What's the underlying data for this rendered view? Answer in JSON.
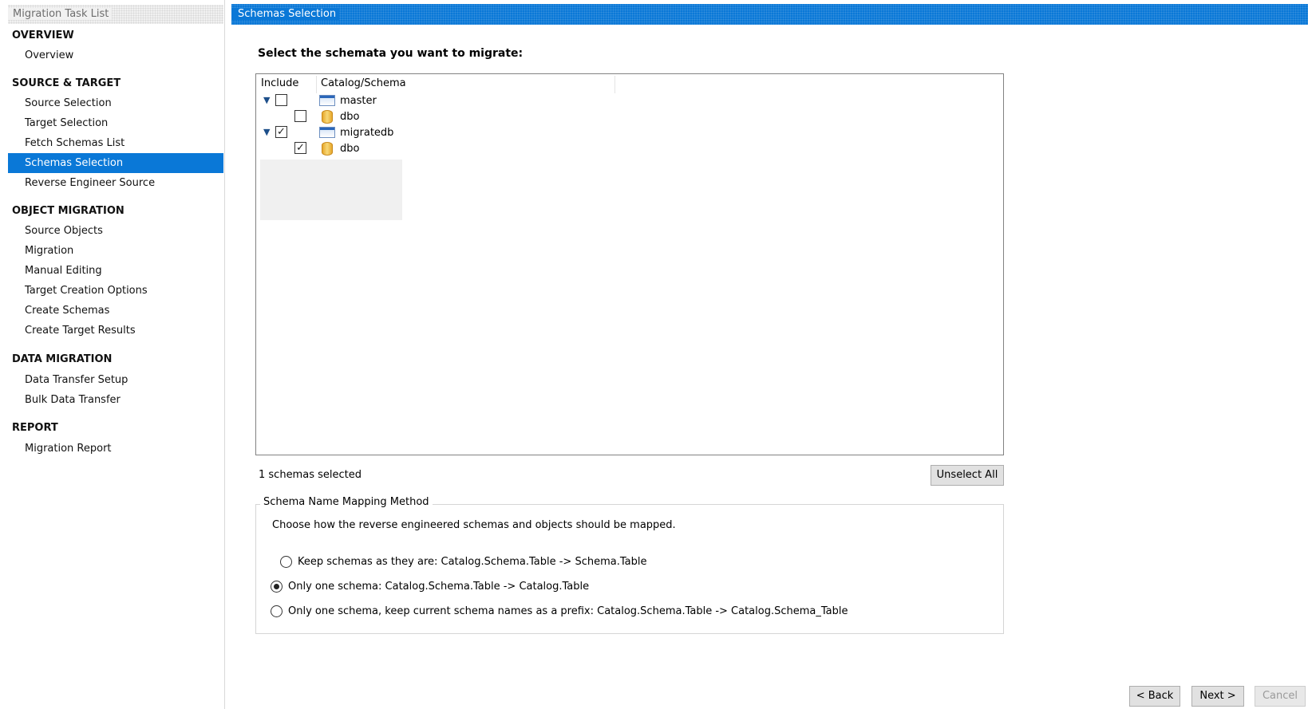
{
  "sidebar": {
    "header": "Migration Task List",
    "sections": [
      {
        "title": "OVERVIEW",
        "items": [
          "Overview"
        ]
      },
      {
        "title": "SOURCE & TARGET",
        "items": [
          "Source Selection",
          "Target Selection",
          "Fetch Schemas List",
          "Schemas Selection",
          "Reverse Engineer Source"
        ]
      },
      {
        "title": "OBJECT MIGRATION",
        "items": [
          "Source Objects",
          "Migration",
          "Manual Editing",
          "Target Creation Options",
          "Create Schemas",
          "Create Target Results"
        ]
      },
      {
        "title": "DATA MIGRATION",
        "items": [
          "Data Transfer Setup",
          "Bulk Data Transfer"
        ]
      },
      {
        "title": "REPORT",
        "items": [
          "Migration Report"
        ]
      }
    ],
    "active_item": "Schemas Selection"
  },
  "page": {
    "title": "Schemas Selection",
    "heading": "Select the schemata you want to migrate:"
  },
  "tree": {
    "columns": [
      "Include",
      "Catalog/Schema"
    ],
    "rows": [
      {
        "label": "master",
        "icon": "catalog-icon",
        "checked": false,
        "level": 0,
        "expanded": true
      },
      {
        "label": "dbo",
        "icon": "database-icon",
        "checked": false,
        "level": 1
      },
      {
        "label": "migratedb",
        "icon": "catalog-icon",
        "checked": true,
        "level": 0,
        "expanded": true
      },
      {
        "label": "dbo",
        "icon": "database-icon",
        "checked": true,
        "level": 1
      }
    ]
  },
  "status": {
    "selected_text": "1 schemas selected",
    "unselect_all_label": "Unselect All"
  },
  "mapping": {
    "legend": "Schema Name Mapping Method",
    "description": "Choose how the reverse engineered schemas and objects should be mapped.",
    "options": [
      {
        "label": "Keep schemas as they are: Catalog.Schema.Table -> Schema.Table",
        "checked": false
      },
      {
        "label": "Only one schema: Catalog.Schema.Table -> Catalog.Table",
        "checked": true
      },
      {
        "label": "Only one schema, keep current schema names as a prefix: Catalog.Schema.Table -> Catalog.Schema_Table",
        "checked": false
      }
    ]
  },
  "footer": {
    "back_label": "< Back",
    "next_label": "Next >",
    "cancel_label": "Cancel"
  },
  "colors": {
    "accent": "#0a78d7"
  }
}
